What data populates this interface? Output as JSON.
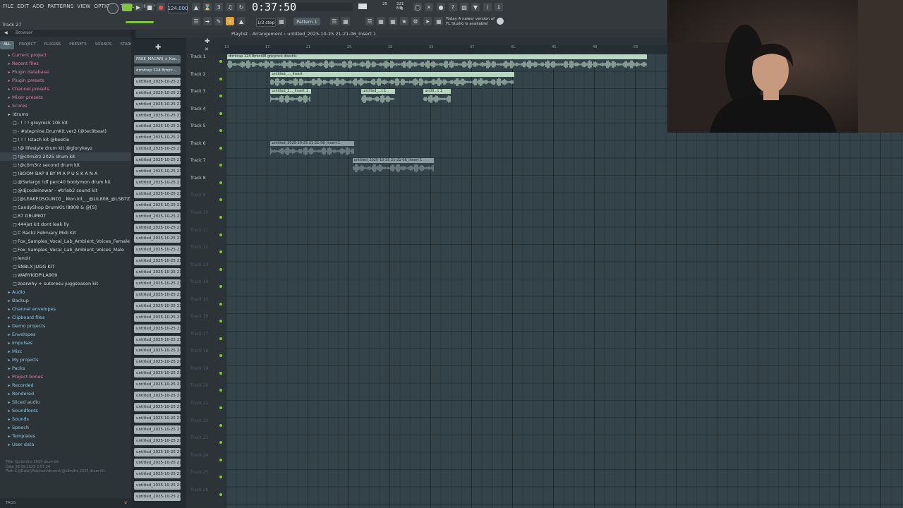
{
  "menu": [
    "FILE",
    "EDIT",
    "ADD",
    "PATTERNS",
    "VIEW",
    "OPTIONS",
    "TOOLS",
    "HELP"
  ],
  "hint": "Track 27",
  "transport": {
    "tempo": "124.000",
    "time": "0:37:50",
    "step": "1/3 step",
    "pattern": "Pattern 1",
    "cpu": "25",
    "mem": "221 MB",
    "mem2": "0"
  },
  "news": {
    "line1": "Today  A newer version of",
    "line2": "FL Studio is available!"
  },
  "browser": {
    "title": "Browser",
    "tabs": [
      "ALL",
      "PROJECT",
      "PLUGINS",
      "PRESETS",
      "SOUNDS",
      "STARRED"
    ],
    "items": [
      {
        "label": "Current project",
        "color": "pink",
        "lev": 0
      },
      {
        "label": "Recent files",
        "color": "pink",
        "lev": 0
      },
      {
        "label": "Plugin database",
        "color": "pink",
        "lev": 0
      },
      {
        "label": "Plugin presets",
        "color": "pink",
        "lev": 0
      },
      {
        "label": "Channel presets",
        "color": "pink",
        "lev": 0
      },
      {
        "label": "Mixer presets",
        "color": "pink",
        "lev": 0
      },
      {
        "label": "Scores",
        "color": "pink",
        "lev": 0
      },
      {
        "label": "!drums",
        "color": "wht",
        "lev": 0
      },
      {
        "label": "- ! ! ! greyrock 10k kit",
        "color": "wht",
        "lev": 1
      },
      {
        "label": "- #stepnine.DrumKit.ver2 (@tec9beat)",
        "color": "wht",
        "lev": 1
      },
      {
        "label": "! ! ! !stash kit @beetle",
        "color": "wht",
        "lev": 1
      },
      {
        "label": "!@ lifestyle drum kit @glorykeyz",
        "color": "wht",
        "lev": 1
      },
      {
        "label": "!@c0m3rz 2025 drum kit",
        "color": "wht",
        "lev": 1,
        "sel": true
      },
      {
        "label": "!@c0m3rz second drum kit",
        "color": "wht",
        "lev": 1
      },
      {
        "label": "!BOOM BAP II BY M A P U S K A N A",
        "color": "wht",
        "lev": 1
      },
      {
        "label": "@Swlargo !df perc40 boolymon drum kit",
        "color": "wht",
        "lev": 1
      },
      {
        "label": "@djcodeinewar - #trlab2 sound kit",
        "color": "wht",
        "lev": 1
      },
      {
        "label": "[@LEAKEDSOUND] _ Mon.kit_ _@LIL808_@LSBTZ",
        "color": "wht",
        "lev": 1
      },
      {
        "label": "CandyShop DrumKit.!8808 & @[S]",
        "color": "wht",
        "lev": 1
      },
      {
        "label": "87 DRUMKIT",
        "color": "wht",
        "lev": 1
      },
      {
        "label": "444jet kit dont leak lly",
        "color": "wht",
        "lev": 1
      },
      {
        "label": "C Rackz February Midi Kit",
        "color": "wht",
        "lev": 1
      },
      {
        "label": "Fox_Samples_Vocal_Lab_Ambient_Voices_Female",
        "color": "wht",
        "lev": 1
      },
      {
        "label": "Fox_Samples_Vocal_Lab_Ambient_Voices_Male",
        "color": "wht",
        "lev": 1
      },
      {
        "label": "lenoir",
        "color": "wht",
        "lev": 1
      },
      {
        "label": "SNBLX JUGG KIT",
        "color": "wht",
        "lev": 1
      },
      {
        "label": "WARYKIDPILA909",
        "color": "wht",
        "lev": 1
      },
      {
        "label": "zoarwhy + sutoresu juggseason kit",
        "color": "wht",
        "lev": 1
      },
      {
        "label": "Audio",
        "color": "blue",
        "lev": 0
      },
      {
        "label": "Backup",
        "color": "blue",
        "lev": 0
      },
      {
        "label": "Channel envelopes",
        "color": "blue",
        "lev": 0
      },
      {
        "label": "Clipboard files",
        "color": "blue",
        "lev": 0
      },
      {
        "label": "Demo projects",
        "color": "blue",
        "lev": 0
      },
      {
        "label": "Envelopes",
        "color": "blue",
        "lev": 0
      },
      {
        "label": "Impulses",
        "color": "blue",
        "lev": 0
      },
      {
        "label": "Misc",
        "color": "blue",
        "lev": 0
      },
      {
        "label": "My projects",
        "color": "blue",
        "lev": 0
      },
      {
        "label": "Packs",
        "color": "blue",
        "lev": 0
      },
      {
        "label": "Project bones",
        "color": "pink",
        "lev": 0
      },
      {
        "label": "Recorded",
        "color": "blue",
        "lev": 0
      },
      {
        "label": "Rendered",
        "color": "blue",
        "lev": 0
      },
      {
        "label": "Sliced audio",
        "color": "blue",
        "lev": 0
      },
      {
        "label": "Soundfonts",
        "color": "blue",
        "lev": 0
      },
      {
        "label": "Sounds",
        "color": "blue",
        "lev": 0
      },
      {
        "label": "Speech",
        "color": "blue",
        "lev": 0
      },
      {
        "label": "Templates",
        "color": "blue",
        "lev": 0
      },
      {
        "label": "User data",
        "color": "blue",
        "lev": 0
      }
    ],
    "info_title": "Title   !@c0m3rz 2025 drum kit",
    "info_date": "Date   28.09.2025 3:57:34",
    "info_path": "Path   C:\\[Data]\\Patches\\!drums\\!@c0m3rz 2025 drum kit",
    "footer": "TAGS"
  },
  "picker": {
    "items": [
      "FREE_MACARI_x_Kac...",
      "drmtrap 124 8mini...",
      "untitled_2025-10-25 21-",
      "untitled_2025-10-25 21-",
      "untitled_2025-10-25 21-",
      "untitled_2025-10-25 21-",
      "untitled_2025-10-25 21-",
      "untitled_2025-10-25 21-",
      "untitled_2025-10-25 21-",
      "untitled_2025-10-25 21-",
      "untitled_2025-10-25 21-",
      "untitled_2025-10-25 21-",
      "untitled_2025-10-25 21-",
      "untitled_2025-10-25 21-",
      "untitled_2025-10-25 21-",
      "untitled_2025-10-25 21-",
      "untitled_2025-10-25 21-",
      "untitled_2025-10-25 21-",
      "untitled_2025-10-25 21-",
      "untitled_2025-10-25 21-",
      "untitled_2025-10-25 21-",
      "untitled_2025-10-25 21-",
      "untitled_2025-10-25 21-",
      "untitled_2025-10-25 21-",
      "untitled_2025-10-25 21-",
      "untitled_2025-10-25 21-",
      "untitled_2025-10-25 21-",
      "untitled_2025-10-25 21-",
      "untitled_2025-10-25 21-",
      "untitled_2025-10-25 21-",
      "untitled_2025-10-25 21-",
      "untitled_2025-10-25 21-",
      "untitled_2025-10-25 21-",
      "untitled_2025-10-25 21-",
      "untitled_2025-10-25 21-",
      "untitled_2025-10-25 21-",
      "untitled_2025-10-25 21-",
      "untitled_2025-10-25 21-",
      "untitled_2025-10-25 21-",
      "untitled_2025-10-25 21-"
    ]
  },
  "playlist": {
    "title": "Playlist - Arrangement  ›  untitled_2025-10-25 21-21-06_Insert 1",
    "ruler": [
      "13",
      "17",
      "21",
      "25",
      "29",
      "33",
      "37",
      "41",
      "45",
      "49",
      "53",
      "57",
      "61"
    ],
    "tracks": [
      "Track 1",
      "Track 2",
      "Track 3",
      "Track 4",
      "Track 5",
      "Track 6",
      "Track 7",
      "Track 8",
      "Track 9",
      "Track 10",
      "Track 11",
      "Track 12",
      "Track 13",
      "Track 14",
      "Track 15",
      "Track 16",
      "Track 17",
      "Track 18",
      "Track 19",
      "Track 20",
      "Track 21",
      "Track 22",
      "Track 23",
      "Track 24",
      "Track 25",
      "Track 26"
    ],
    "clips": [
      {
        "label": "drmtrap 124 8mini48 greyrock diwshis",
        "track": 0,
        "start": 0.0,
        "len": 0.62,
        "color": "#b9d6c2"
      },
      {
        "label": "untitled_..._Insert",
        "track": 1,
        "start": 0.064,
        "len": 0.36,
        "color": "#b9d6c2"
      },
      {
        "label": "untitled_2..._Insert 1",
        "track": 2,
        "start": 0.064,
        "len": 0.06,
        "color": "#b9d6c2"
      },
      {
        "label": "untitled_...t 1",
        "track": 2,
        "start": 0.198,
        "len": 0.05,
        "color": "#b9d6c2"
      },
      {
        "label": "untitl...t 1",
        "track": 2,
        "start": 0.29,
        "len": 0.04,
        "color": "#b9d6c2"
      },
      {
        "label": "untitled_2025-10-25 21-21-06_Insert 1",
        "track": 5,
        "start": 0.064,
        "len": 0.123,
        "color": "#8a9aa0"
      },
      {
        "label": "untitled_2025-10-25 21-21-06_Insert 1",
        "track": 6,
        "start": 0.185,
        "len": 0.12,
        "color": "#8a9aa0"
      }
    ]
  }
}
